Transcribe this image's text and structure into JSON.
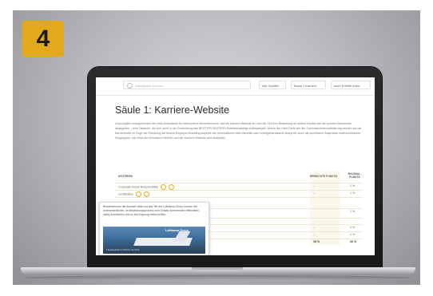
{
  "badge": {
    "number": "4",
    "color": "#e4a91a"
  },
  "site": {
    "search_placeholder": "Arbeitgeber suchen...",
    "dropdowns": [
      "Alle Spalten",
      "Basis 1 Karriere",
      "nach Erfüllte Anfor."
    ],
    "page_title": "Säule 1: Karriere-Website",
    "paragraph": "Ursprünglich unangefochten die erste Anlaufstelle für interessierte Bewerberinnen, hat die Karriere-Website im Lauf der Zeit ihre Bedeutung an andere Kanäle wie die sozialen Netzwerke abgegeben – eine Tatsache, die sich auch in der Gewichtung des BEST RECRUITERS-Kriterienkatalogs widerspiegelt. Neben der Hard Facts wie der Suchmaschinenoptimierung wurden auf der Karriereseite im Zuge der Erhebung auf frische Employer-Branding-Aspekte wie Informationen über Benefits oder Arbeitgeberawards überprüft. Auch die spezifische Ansprache unterschiedlicher Zielgruppen, wie etwa der technische Bereich, auf der Karriere-Website wird analysiert.",
    "table": {
      "headers": [
        "KRITERIEN",
        "ERREICHTE PUNKTE",
        "MAXIMAL-PUNKTE"
      ],
      "rows": [
        {
          "label": "Corporate Social Responsibility",
          "c1": "–",
          "c2": "1 %"
        },
        {
          "label": "Certification",
          "c1": "–",
          "c2": "1 %"
        },
        {
          "label": "",
          "c1": "",
          "c2": ""
        },
        {
          "label": "",
          "c1": "",
          "c2": "1 %"
        },
        {
          "label": "",
          "c1": "",
          "c2": ""
        },
        {
          "label": "",
          "c1": "–",
          "c2": "1 %"
        },
        {
          "label": "",
          "c1": "–",
          "c2": "1 %"
        },
        {
          "label": "",
          "c1": "15 %",
          "c2": "20 %"
        }
      ]
    },
    "popup": {
      "text": "Bewerberinnen die Auswahl stillen ist das Teil der Lufthansa Group können die unterschiedlichen, im Bewerbungsprozess zum Einsatz kommenden Hilfsmitteln stetig durchlaufen und so ihre Eignung selbst prüfen.",
      "image_title": "Lufthansa Group",
      "image_caption": "Flugbegleiter/in   Pilot/in   Technik"
    }
  }
}
